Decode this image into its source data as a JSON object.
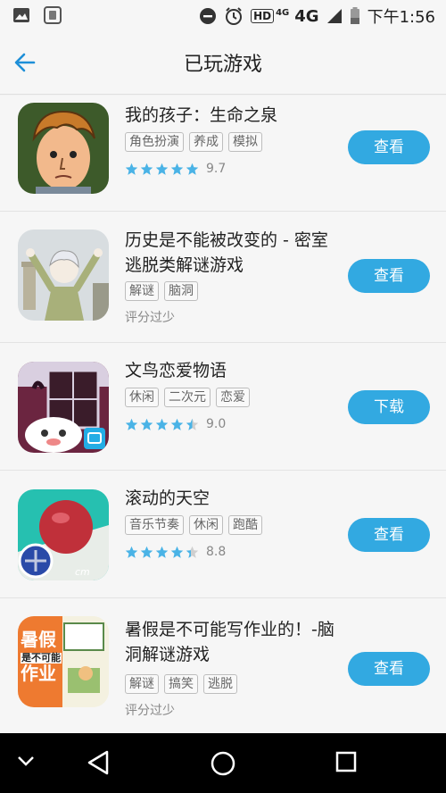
{
  "status_bar": {
    "network_label": "HD",
    "network_4g_small": "4G",
    "network_4g": "4G",
    "time": "下午1:56"
  },
  "header": {
    "title": "已玩游戏",
    "back_icon": "arrow-left-icon"
  },
  "accent_color": "#32a9e1",
  "games": [
    {
      "name": "我的孩子：生命之泉",
      "tags": [
        "角色扮演",
        "养成",
        "模拟"
      ],
      "stars": 5,
      "score": "9.7",
      "rating_text": "",
      "button": "查看"
    },
    {
      "name": "历史是不能被改变的 - 密室逃脱类解谜游戏",
      "tags": [
        "解谜",
        "脑洞"
      ],
      "stars": 0,
      "score": "",
      "rating_text": "评分过少",
      "button": "查看"
    },
    {
      "name": "文鸟恋爱物语",
      "tags": [
        "休闲",
        "二次元",
        "恋爱"
      ],
      "stars": 4.5,
      "score": "9.0",
      "rating_text": "",
      "button": "下载"
    },
    {
      "name": "滚动的天空",
      "tags": [
        "音乐节奏",
        "休闲",
        "跑酷"
      ],
      "stars": 4.5,
      "score": "8.8",
      "rating_text": "",
      "button": "查看"
    },
    {
      "name": "暑假是不可能写作业的！-脑洞解谜游戏",
      "tags": [
        "解谜",
        "搞笑",
        "逃脱"
      ],
      "stars": 0,
      "score": "",
      "rating_text": "评分过少",
      "button": "查看"
    }
  ],
  "icon_text": {
    "game5_line1": "暑假",
    "game5_line2": "是不可能",
    "game5_line3": "作业"
  }
}
